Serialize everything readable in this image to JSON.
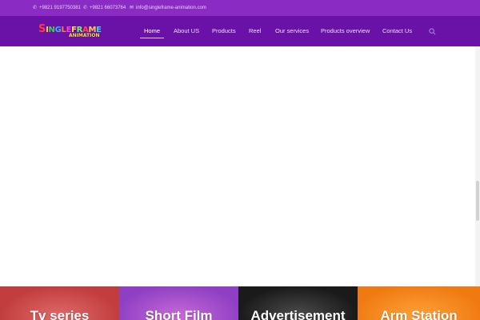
{
  "topbar": {
    "phone1": "+9821 9197750381",
    "phone2": "+9821 66073764",
    "email": "info@singleframe-animation.com"
  },
  "logo": {
    "line1": "SINGLEFRAME",
    "line2": "ANIMATION",
    "letter_colors": [
      "#ff3b3b",
      "#ffd23a",
      "#3bd14a",
      "#3ab0ff",
      "#ff7a2a",
      "#ff3bd0",
      "#ffe14a",
      "#6cff5a",
      "#ff4a4a",
      "#ffd23a",
      "#38d1ff"
    ]
  },
  "nav": {
    "items": [
      {
        "label": "Home",
        "active": true
      },
      {
        "label": "About US"
      },
      {
        "label": "Products"
      },
      {
        "label": "Reel"
      },
      {
        "label": "Our services"
      },
      {
        "label": "Products overview"
      },
      {
        "label": "Contact Us"
      }
    ]
  },
  "tiles": [
    {
      "title": "Tv series"
    },
    {
      "title": "Short Film"
    },
    {
      "title": "Advertisement"
    },
    {
      "title": "Arm Station"
    }
  ],
  "colors": {
    "topbar": "#8a2bc4",
    "header": "#6a12a8"
  }
}
